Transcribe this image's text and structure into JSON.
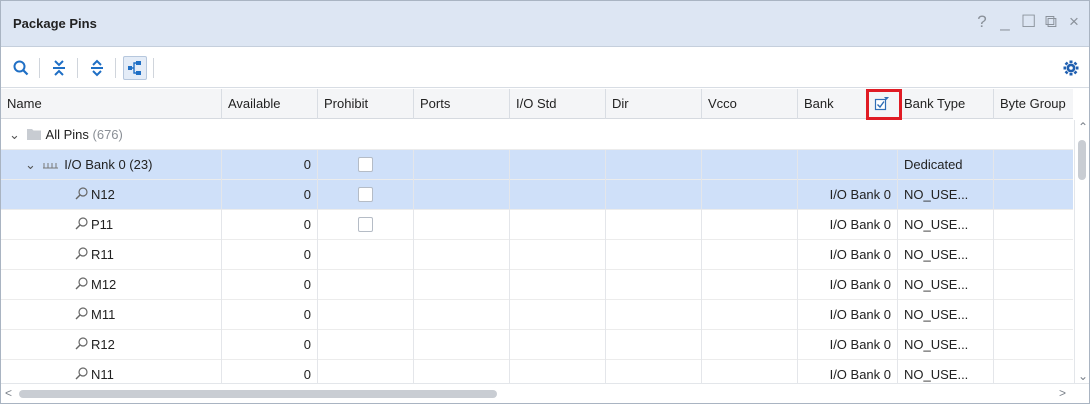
{
  "panel": {
    "title": "Package Pins"
  },
  "window_controls": [
    "?",
    "_",
    "☐",
    "⧉",
    "×"
  ],
  "columns": [
    "Name",
    "Available",
    "Prohibit",
    "Ports",
    "I/O Std",
    "Dir",
    "Vcco",
    "Bank",
    "Bank Type",
    "Byte Group"
  ],
  "tree": {
    "all_pins": {
      "label": "All Pins",
      "count": "(676)"
    },
    "bank": {
      "label": "I/O Bank 0 (23)",
      "available": "0",
      "bank_type": "Dedicated"
    }
  },
  "pins": [
    {
      "name": "N12",
      "available": "0",
      "prohibit_checkbox": true,
      "bank": "I/O Bank 0",
      "bank_type": "NO_USE...",
      "selected": true
    },
    {
      "name": "P11",
      "available": "0",
      "prohibit_checkbox": true,
      "bank": "I/O Bank 0",
      "bank_type": "NO_USE...",
      "selected": false
    },
    {
      "name": "R11",
      "available": "0",
      "prohibit_checkbox": false,
      "bank": "I/O Bank 0",
      "bank_type": "NO_USE...",
      "selected": false
    },
    {
      "name": "M12",
      "available": "0",
      "prohibit_checkbox": false,
      "bank": "I/O Bank 0",
      "bank_type": "NO_USE...",
      "selected": false
    },
    {
      "name": "M11",
      "available": "0",
      "prohibit_checkbox": false,
      "bank": "I/O Bank 0",
      "bank_type": "NO_USE...",
      "selected": false
    },
    {
      "name": "R12",
      "available": "0",
      "prohibit_checkbox": false,
      "bank": "I/O Bank 0",
      "bank_type": "NO_USE...",
      "selected": false
    },
    {
      "name": "N11",
      "available": "0",
      "prohibit_checkbox": false,
      "bank": "I/O Bank 0",
      "bank_type": "NO_USE...",
      "selected": false
    }
  ],
  "icons": {
    "toolbar": [
      "search-icon",
      "collapse-all-icon",
      "expand-all-icon",
      "group-by-bank-icon"
    ],
    "settings": "gear-icon",
    "highlighted_header_icon": "bank-type-filter-icon"
  },
  "colors": {
    "accent": "#1f6fc5",
    "selection": "#cfe0f9",
    "highlight": "#e01b24",
    "title_bg": "#dde6f3"
  }
}
